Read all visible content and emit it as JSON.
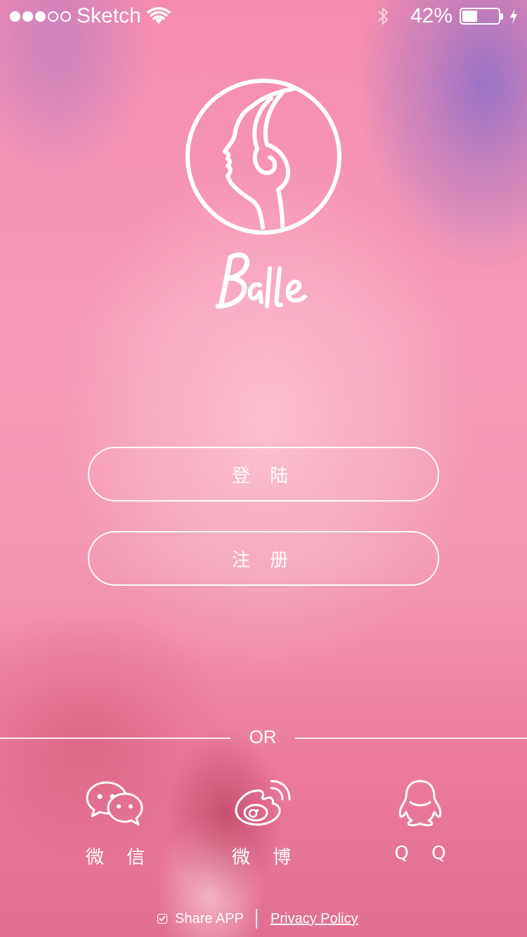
{
  "status_bar": {
    "carrier": "Sketch",
    "battery_percent": "42%",
    "battery_level": 0.42,
    "signal_strength_filled": 3,
    "signal_strength_total": 5,
    "icons": [
      "wifi-icon",
      "bluetooth-icon",
      "battery-icon",
      "charging-icon"
    ]
  },
  "brand": {
    "logo_icon": "woman-profile-logo",
    "wordmark_icon": "bayie-wordmark"
  },
  "actions": {
    "login_label": "登 陆",
    "register_label": "注 册"
  },
  "divider": {
    "text": "OR"
  },
  "social": [
    {
      "label": "微 信",
      "icon": "wechat-icon"
    },
    {
      "label": "微 博",
      "icon": "weibo-icon"
    },
    {
      "label": "Q Q",
      "icon": "qq-icon"
    }
  ],
  "footer": {
    "share_label": "Share APP",
    "share_checked": true,
    "privacy_label": "Privacy Policy"
  },
  "colors": {
    "background": "#f497b3",
    "foreground": "#ffffff"
  }
}
